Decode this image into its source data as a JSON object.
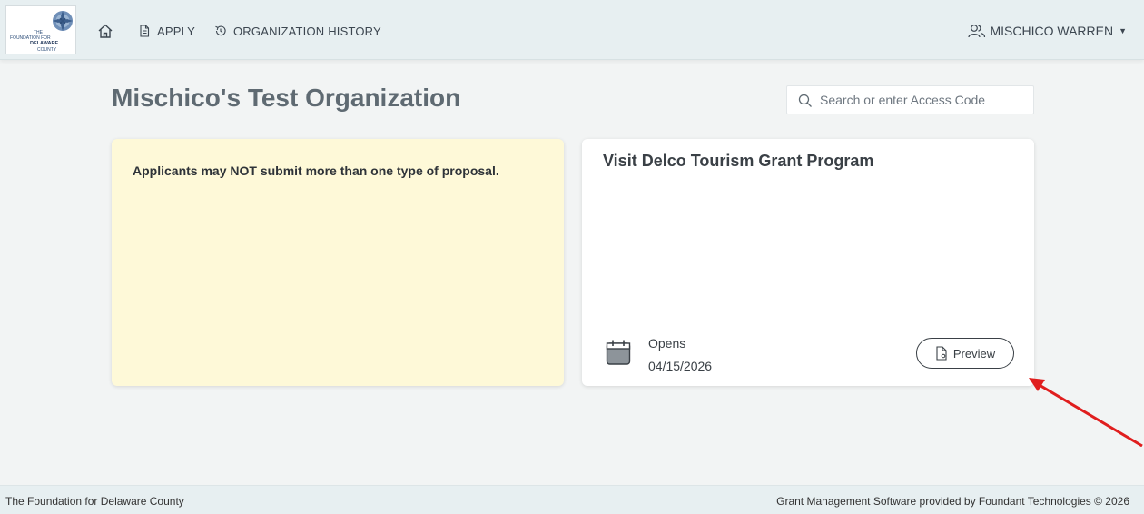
{
  "header": {
    "logo": {
      "text_line1": "THE",
      "text_line2": "FOUNDATION FOR",
      "text_line3": "DELAWARE",
      "text_line4": "COUNTY",
      "icon": "foundation-logo-mark"
    },
    "nav": {
      "home_icon": "home-icon",
      "apply_label": "APPLY",
      "apply_icon": "document-icon",
      "history_label": "ORGANIZATION HISTORY",
      "history_icon": "history-icon"
    },
    "user": {
      "name": "MISCHICO WARREN",
      "icon": "users-icon",
      "caret_icon": "caret-down-icon"
    }
  },
  "main": {
    "org_title": "Mischico's Test Organization",
    "search": {
      "placeholder": "Search or enter Access Code",
      "value": "",
      "icon": "search-icon"
    },
    "notice": {
      "text_before": "Applicants may ",
      "text_emphasis": "NOT",
      "text_after": " submit more than one type of proposal."
    },
    "grant": {
      "title": "Visit Delco Tourism Grant Program",
      "opens_label": "Opens",
      "opens_date": "04/15/2026",
      "calendar_icon": "calendar-icon",
      "preview_label": "Preview",
      "preview_icon": "file-preview-icon"
    }
  },
  "annotation": {
    "arrow_color": "#e01e1e"
  },
  "footer": {
    "left": "The Foundation for Delaware County",
    "right": "Grant Management Software provided by Foundant Technologies © 2026"
  },
  "colors": {
    "topbar_bg": "#e7eff1",
    "page_bg": "#f2f4f4",
    "notice_bg": "#fef9d8",
    "title_color": "#5f6a72"
  }
}
